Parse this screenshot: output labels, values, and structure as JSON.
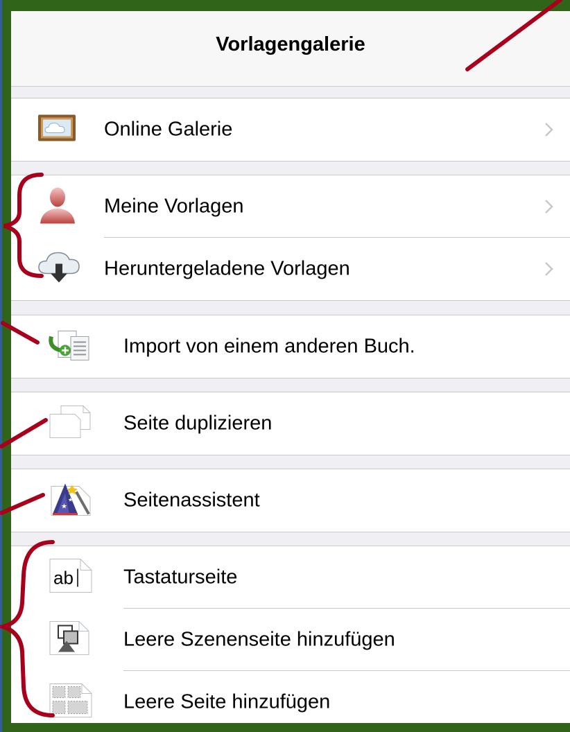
{
  "header": {
    "title": "Vorlagengalerie"
  },
  "groups": [
    {
      "items": [
        {
          "label": "Online Galerie",
          "icon": "framed-cloud-icon",
          "chevron": true
        }
      ]
    },
    {
      "items": [
        {
          "label": "Meine Vorlagen",
          "icon": "user-silhouette-icon",
          "chevron": true
        },
        {
          "label": "Heruntergeladene Vorlagen",
          "icon": "cloud-download-icon",
          "chevron": true
        }
      ]
    },
    {
      "items": [
        {
          "label": "Import von einem anderen Buch.",
          "icon": "import-book-icon",
          "chevron": false
        }
      ]
    },
    {
      "items": [
        {
          "label": "Seite duplizieren",
          "icon": "duplicate-pages-icon",
          "chevron": false
        }
      ]
    },
    {
      "items": [
        {
          "label": "Seitenassistent",
          "icon": "wizard-hat-icon",
          "chevron": false
        }
      ]
    },
    {
      "items": [
        {
          "label": "Tastaturseite",
          "icon": "keyboard-page-icon",
          "icon_text": "ab",
          "chevron": false
        },
        {
          "label": "Leere Szenenseite hinzufügen",
          "icon": "scene-page-icon",
          "chevron": false
        },
        {
          "label": "Leere Seite hinzufügen",
          "icon": "blank-grid-page-icon",
          "chevron": false
        }
      ]
    }
  ],
  "colors": {
    "frame": "#2f6419",
    "frame_left_edge": "#2f5f9c",
    "annotation": "#a8001c",
    "separator": "#c8c7cc",
    "chevron": "#c7c7cc"
  }
}
